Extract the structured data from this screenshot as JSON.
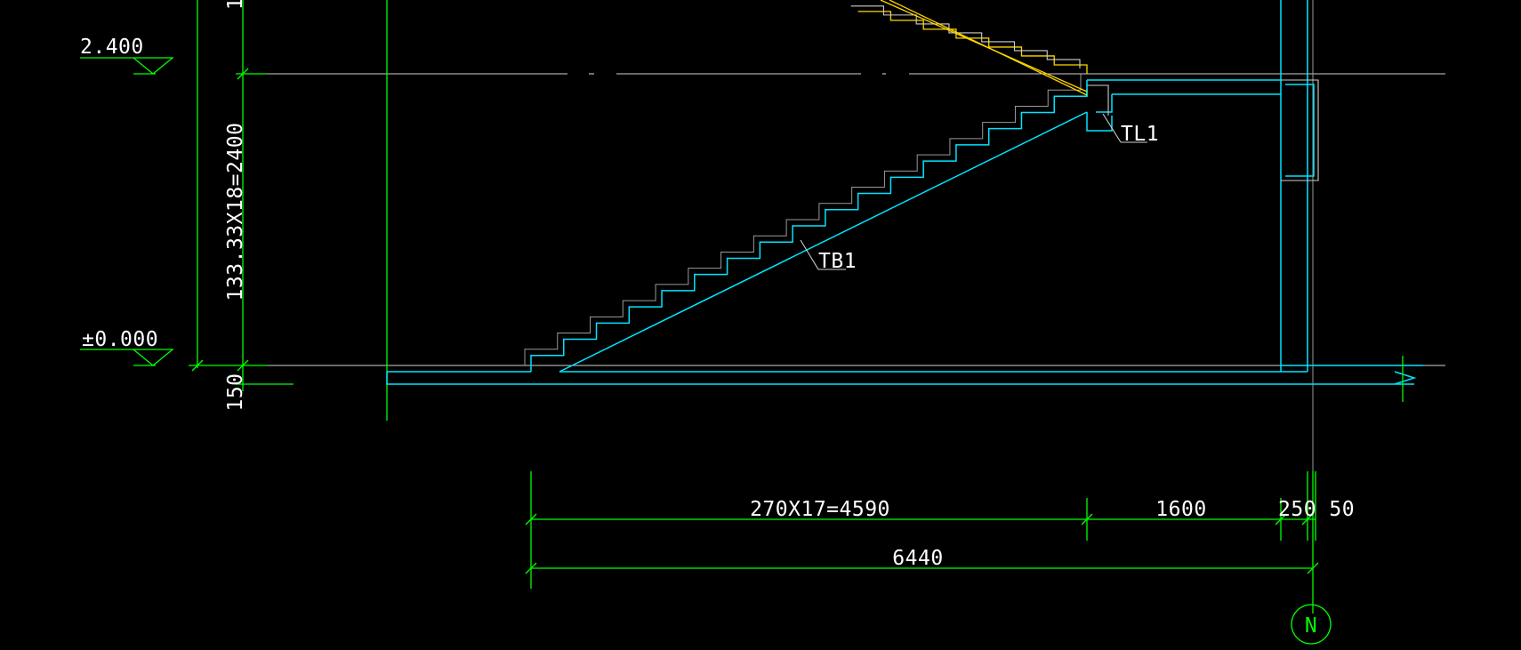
{
  "levels": {
    "upper": "2.400",
    "ground": "±0.000"
  },
  "vertical_dims": {
    "riser_dim": "133.33X18=2400",
    "slab_dim": "150",
    "top_partial": "1"
  },
  "horizontal_dims": {
    "flight": "270X17=4590",
    "landing": "1600",
    "end_segments": "250 50",
    "total": "6440"
  },
  "callouts": {
    "beam": "TL1",
    "slab": "TB1"
  },
  "axis": {
    "label": "N"
  },
  "colors": {
    "background": "#000000",
    "dimension": "#00ff00",
    "structure": "#00e5ff",
    "upper_stair": "#ffd700",
    "text": "#ffffff"
  }
}
